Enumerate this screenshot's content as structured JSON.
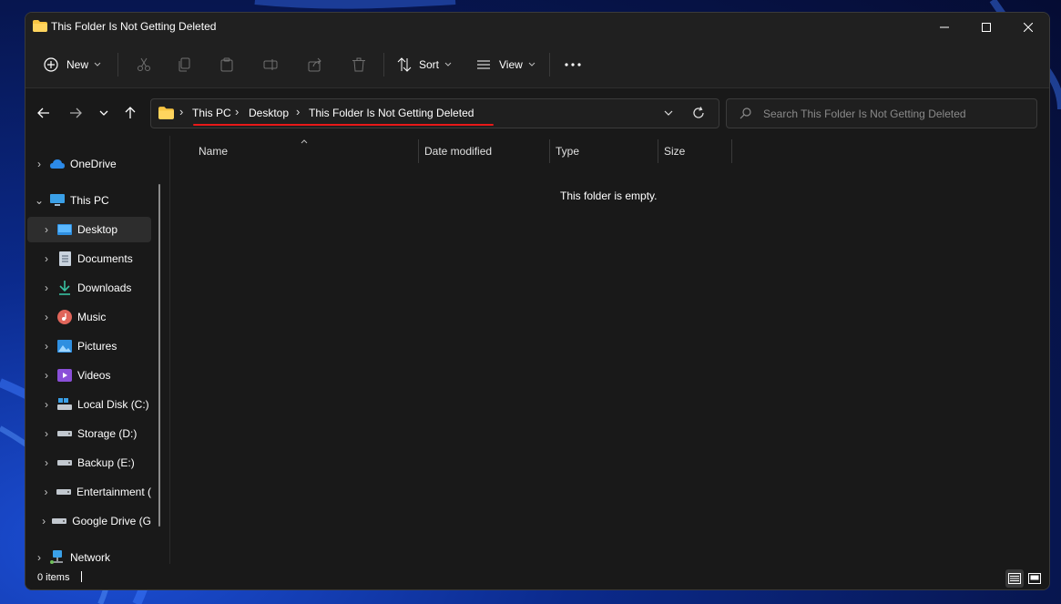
{
  "window": {
    "title": "This Folder Is Not Getting Deleted"
  },
  "toolbar": {
    "new_label": "New",
    "sort_label": "Sort",
    "view_label": "View"
  },
  "address": {
    "crumbs": [
      "This PC",
      "Desktop",
      "This Folder Is Not Getting Deleted"
    ],
    "underline_color": "#e81818"
  },
  "search": {
    "placeholder": "Search This Folder Is Not Getting Deleted"
  },
  "sidebar": {
    "items": [
      {
        "label": "OneDrive",
        "icon": "onedrive-icon"
      },
      {
        "label": "This PC",
        "icon": "computer-icon"
      },
      {
        "label": "Desktop",
        "icon": "desktop-icon"
      },
      {
        "label": "Documents",
        "icon": "documents-icon"
      },
      {
        "label": "Downloads",
        "icon": "downloads-icon"
      },
      {
        "label": "Music",
        "icon": "music-icon"
      },
      {
        "label": "Pictures",
        "icon": "pictures-icon"
      },
      {
        "label": "Videos",
        "icon": "videos-icon"
      },
      {
        "label": "Local Disk (C:)",
        "icon": "local-disk-icon"
      },
      {
        "label": "Storage (D:)",
        "icon": "drive-icon"
      },
      {
        "label": "Backup (E:)",
        "icon": "drive-icon"
      },
      {
        "label": "Entertainment (",
        "icon": "drive-icon"
      },
      {
        "label": "Google Drive (G",
        "icon": "drive-icon"
      },
      {
        "label": "Network",
        "icon": "network-icon"
      }
    ]
  },
  "columns": {
    "name": "Name",
    "date_modified": "Date modified",
    "type": "Type",
    "size": "Size"
  },
  "content": {
    "empty_message": "This folder is empty."
  },
  "status": {
    "items_count": "0 items"
  }
}
